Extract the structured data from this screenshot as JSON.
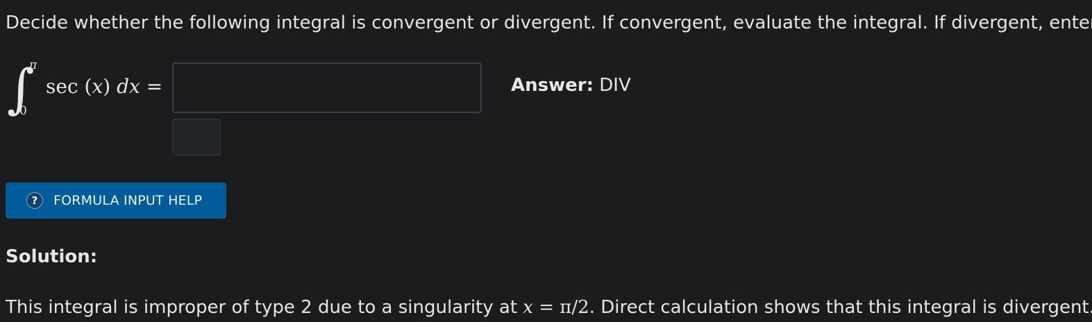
{
  "question": {
    "text": "Decide whether the following integral is convergent or divergent. If convergent, evaluate the integral. If divergent, enter DIV."
  },
  "integral": {
    "symbol": "∫",
    "upper": "π",
    "lower": "0",
    "func": "sec",
    "open_paren": "(",
    "var": "x",
    "close_paren": ")",
    "differential": "dx",
    "equals": "="
  },
  "answer_input": {
    "value": "",
    "placeholder": ""
  },
  "answer_key": {
    "label": "Answer:",
    "value": "DIV"
  },
  "help_button": {
    "icon": "?",
    "label": "FORMULA INPUT HELP",
    "color": "#015d99"
  },
  "solution": {
    "title": "Solution:",
    "text_before": "This integral is improper of type 2 due to a singularity at ",
    "math_var": "x",
    "math_eq": " = ",
    "math_val": "π/2",
    "text_after": ". Direct calculation shows that this integral is divergent."
  }
}
